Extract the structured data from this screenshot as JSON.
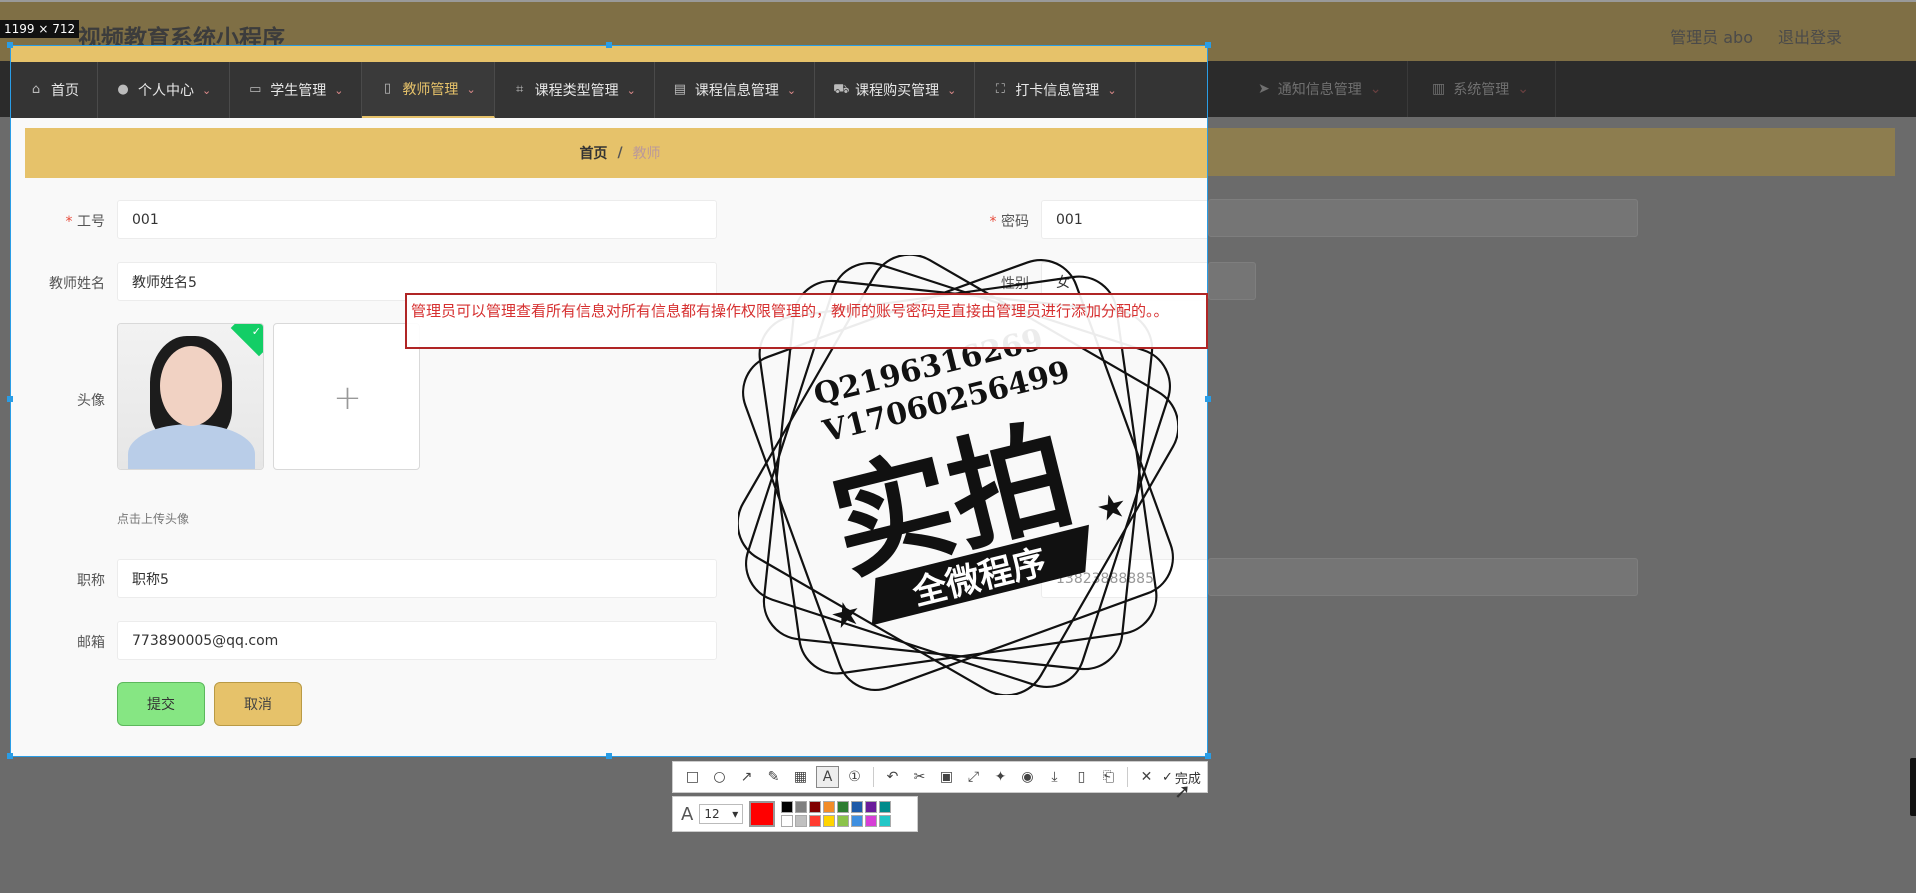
{
  "app": {
    "title": "视频教育系统小程序",
    "admin": "管理员 abo",
    "logout": "退出登录"
  },
  "selection": {
    "size_label": "1199 × 712"
  },
  "nav": [
    {
      "label": "首页",
      "icon": "home-icon",
      "caret": false
    },
    {
      "label": "个人中心",
      "icon": "user-icon",
      "caret": true
    },
    {
      "label": "学生管理",
      "icon": "card-icon",
      "caret": true
    },
    {
      "label": "教师管理",
      "icon": "mic-icon",
      "caret": true,
      "active": true
    },
    {
      "label": "课程类型管理",
      "icon": "crop-icon",
      "caret": true
    },
    {
      "label": "课程信息管理",
      "icon": "clipboard-icon",
      "caret": true
    },
    {
      "label": "课程购买管理",
      "icon": "cart-icon",
      "caret": true
    },
    {
      "label": "打卡信息管理",
      "icon": "scan-icon",
      "caret": true
    }
  ],
  "nav_dim": [
    {
      "label": "通知信息管理",
      "icon": "send-icon"
    },
    {
      "label": "系统管理",
      "icon": "trash-icon"
    }
  ],
  "breadcrumb": {
    "home": "首页",
    "sep": "/",
    "current": "教师"
  },
  "form": {
    "job_no": {
      "label": "工号",
      "value": "001"
    },
    "password": {
      "label": "密码",
      "value": "001"
    },
    "name": {
      "label": "教师姓名",
      "value": "教师姓名5"
    },
    "gender": {
      "label": "性别",
      "value": "女"
    },
    "avatar": {
      "label": "头像",
      "hint": "点击上传头像",
      "plus": "+"
    },
    "title": {
      "label": "职称",
      "value": "职称5"
    },
    "phone": {
      "value": "13823888885"
    },
    "email": {
      "label": "邮箱",
      "value": "773890005@qq.com"
    },
    "submit": "提交",
    "cancel": "取消"
  },
  "annotation": {
    "text": "管理员可以管理查看所有信息对所有信息都有操作权限管理的，教师的账号密码是直接由管理员进行添加分配的。。"
  },
  "stamp": {
    "line1": "Q2196316269",
    "line2": "V17060256499",
    "main": "实拍",
    "ribbon": "全微程序"
  },
  "toolbar": {
    "tools": [
      "rect-icon",
      "ellipse-icon",
      "arrow-icon",
      "pencil-icon",
      "mosaic-icon",
      "text-icon",
      "number-icon",
      "undo-icon",
      "cut-icon",
      "ocr-icon",
      "expand-icon",
      "pin-icon",
      "record-icon",
      "download-icon",
      "phone-icon",
      "bookmark-icon",
      "close-icon"
    ],
    "done": "完成",
    "font_size": "12",
    "current_color": "#ff0000",
    "palette": [
      "#000000",
      "#808080",
      "#800000",
      "#f28c28",
      "#2e7d32",
      "#1e5aa8",
      "#6a1b9a",
      "#008b8b",
      "#ffffff",
      "#c0c0c0",
      "#ff3b30",
      "#ffd400",
      "#8bc34a",
      "#3f8fe0",
      "#d63fd6",
      "#22c7c7"
    ]
  }
}
